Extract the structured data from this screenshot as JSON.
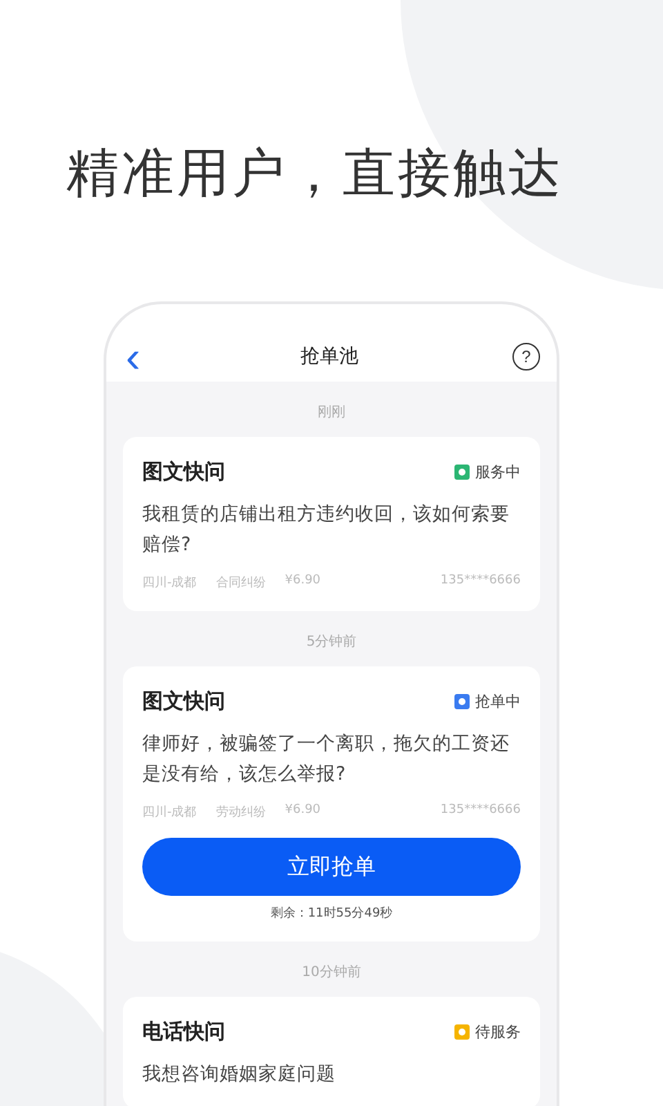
{
  "headline": "精准用户，直接触达",
  "header": {
    "back": "‹",
    "title": "抢单池",
    "help": "?"
  },
  "groups": [
    {
      "time": "刚刚",
      "card": {
        "type": "图文快问",
        "status": "服务中",
        "color": "#2bb673",
        "question": "我租赁的店铺出租方违约收回，该如何索要赔偿?",
        "location": "四川-成都",
        "category": "合同纠纷",
        "price": "¥6.90",
        "phone": "135****6666"
      }
    },
    {
      "time": "5分钟前",
      "card": {
        "type": "图文快问",
        "status": "抢单中",
        "color": "#3a7bf0",
        "question": "律师好，被骗签了一个离职，拖欠的工资还是没有给，该怎么举报?",
        "location": "四川-成都",
        "category": "劳动纠纷",
        "price": "¥6.90",
        "phone": "135****6666",
        "action": "立即抢单",
        "remaining": "剩余：11时55分49秒"
      }
    },
    {
      "time": "10分钟前",
      "card": {
        "type": "电话快问",
        "status": "待服务",
        "color": "#f5b400",
        "question": "我想咨询婚姻家庭问题"
      }
    }
  ]
}
